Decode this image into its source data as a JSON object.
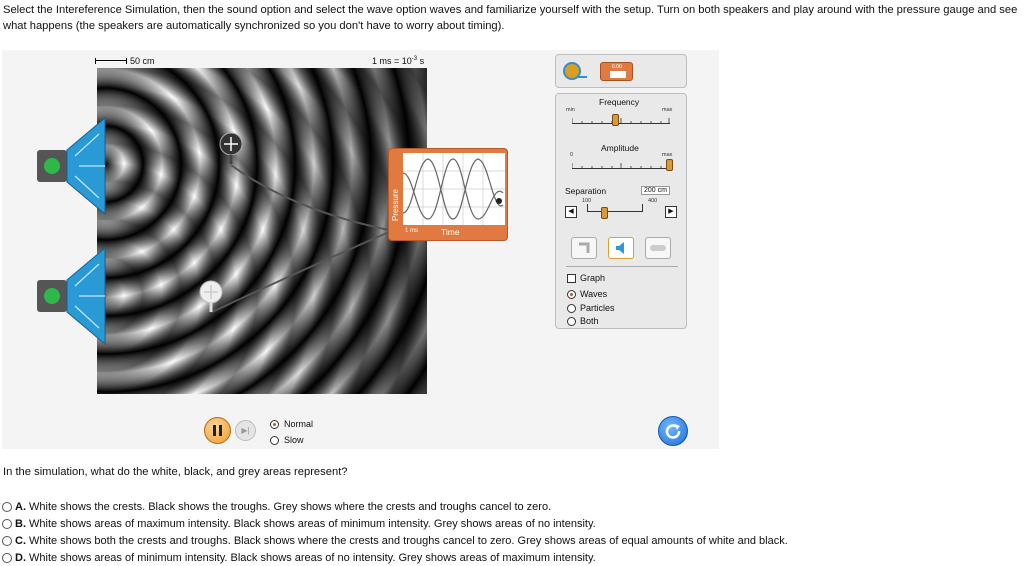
{
  "instructions": "Select the Intereference Simulation, then the sound option and select the wave option waves and familiarize yourself with the setup. Turn on both speakers and play around with the pressure gauge and see what happens (the speakers are automatically synchronized so you don't have to worry about timing).",
  "simulation": {
    "length_scale": "50 cm",
    "time_scale_base": "1 ms = 10",
    "time_scale_exp": "-3",
    "time_scale_unit": " s",
    "gauge": {
      "y_label": "Pressure",
      "x_label": "Time",
      "unit_label": "1 ms"
    },
    "top_panel": {
      "stopwatch_text": "0.00"
    },
    "controls": {
      "frequency": {
        "label": "Frequency",
        "min_label": "min",
        "max_label": "max",
        "level": 0.45
      },
      "amplitude": {
        "label": "Amplitude",
        "min_label": "0",
        "max_label": "max",
        "level": 1.0
      },
      "separation": {
        "label": "Separation",
        "value": "200 cm",
        "min": "100",
        "max": "400",
        "level": 0.33
      },
      "view_options": [
        {
          "label": "Graph",
          "type": "checkbox",
          "checked": false
        },
        {
          "label": "Waves",
          "type": "radio",
          "checked": true
        },
        {
          "label": "Particles",
          "type": "radio",
          "checked": false
        },
        {
          "label": "Both",
          "type": "radio",
          "checked": false
        }
      ]
    },
    "speed_options": [
      {
        "label": "Normal",
        "selected": true
      },
      {
        "label": "Slow",
        "selected": false
      }
    ]
  },
  "question": "In the simulation, what do the white, black, and grey areas represent?",
  "answers": [
    {
      "letter": "A.",
      "text": " White shows the crests. Black shows the troughs. Grey shows where the crests and troughs cancel to zero."
    },
    {
      "letter": "B.",
      "text": " White shows areas of maximum intensity. Black shows areas of minimum intensity. Grey shows areas of no intensity."
    },
    {
      "letter": "C.",
      "text": " White shows both the crests and troughs. Black shows where the crests and troughs cancel to zero. Grey shows areas of equal amounts of white and black."
    },
    {
      "letter": "D.",
      "text": " White shows areas of minimum intensity. Black shows areas of no intensity. Grey shows areas of maximum intensity."
    }
  ],
  "colors": {
    "accent_orange": "#e07a40",
    "reset_blue": "#1f6fd6",
    "speaker_blue": "#2a9ad6",
    "speaker_button_green": "#2fb84a"
  }
}
